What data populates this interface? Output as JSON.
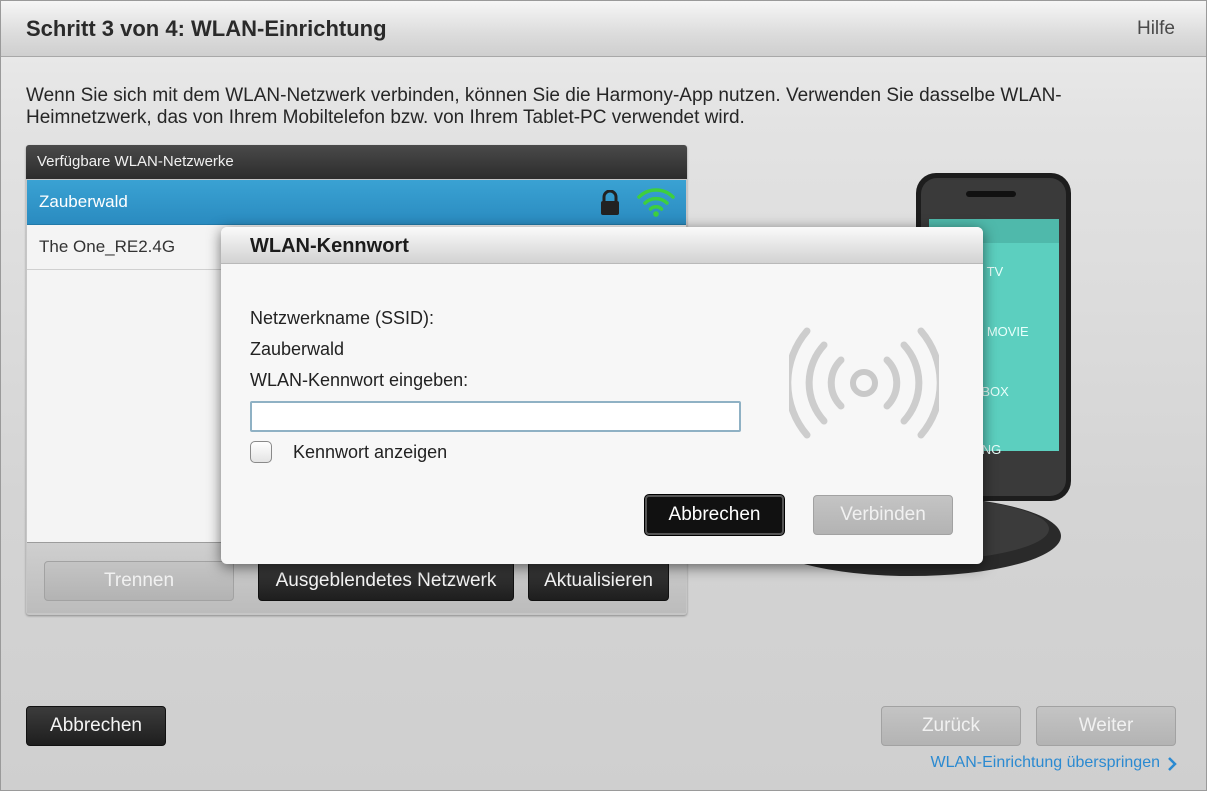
{
  "header": {
    "step_title": "Schritt 3 von 4: WLAN-Einrichtung",
    "help": "Hilfe"
  },
  "intro": {
    "line1": "Wenn Sie sich mit dem WLAN-Netzwerk verbinden, können Sie die Harmony-App nutzen. Verwenden Sie dasselbe WLAN-",
    "line2": "Heimnetzwerk, das von Ihrem Mobiltelefon bzw. von Ihrem Tablet-PC verwendet wird."
  },
  "networks": {
    "header": "Verfügbare WLAN-Netzwerke",
    "items": [
      {
        "name": "Zauberwald",
        "selected": true,
        "secured": true,
        "signal_icon": "wifi-icon"
      },
      {
        "name": "The One_RE2.4G",
        "selected": false
      }
    ],
    "buttons": {
      "disconnect": "Trennen",
      "hidden_network": "Ausgeblendetes Netzwerk",
      "refresh": "Aktualisieren"
    }
  },
  "dialog": {
    "title": "WLAN-Kennwort",
    "ssid_label": "Netzwerkname (SSID):",
    "ssid_value": "Zauberwald",
    "password_label": "WLAN-Kennwort eingeben:",
    "password_value": "",
    "show_password_label": "Kennwort anzeigen",
    "show_password_checked": false,
    "cancel": "Abbrechen",
    "connect": "Verbinden"
  },
  "footer": {
    "cancel": "Abbrechen",
    "back": "Zurück",
    "next": "Weiter",
    "skip": "WLAN-Einrichtung überspringen"
  },
  "phone_screen": {
    "items": [
      "WATCH TV",
      "WATCH MOVIE",
      "PLAY XBOX",
      "COMMING"
    ]
  },
  "colors": {
    "accent": "#2a8bc0",
    "wifi_green": "#3ecf3e",
    "link": "#2b8ad1"
  }
}
